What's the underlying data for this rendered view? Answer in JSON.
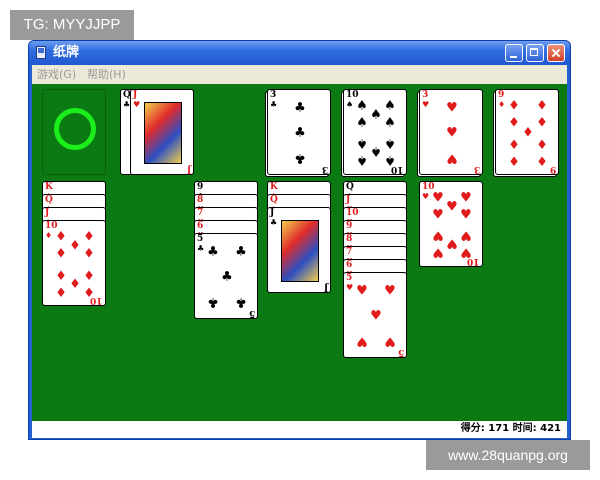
{
  "watermark_top": "TG: MYYJJPP",
  "watermark_bottom": "www.28quanpg.org",
  "window": {
    "title": "纸牌"
  },
  "menu": {
    "game": "游戏(G)",
    "help": "帮助(H)"
  },
  "status": {
    "text": "得分: 171 时间: 421"
  },
  "colors": {
    "felt": "#0c7a12",
    "ring": "#1bef1b",
    "red": "#e01b1b"
  },
  "waste": [
    "Q♣",
    "J♥"
  ],
  "foundations": [
    {
      "rank": "3",
      "suit": "♣",
      "color": "black"
    },
    {
      "rank": "10",
      "suit": "♠",
      "color": "black"
    },
    {
      "rank": "3",
      "suit": "♥",
      "color": "red"
    },
    {
      "rank": "9",
      "suit": "♦",
      "color": "red"
    }
  ],
  "tableau": [
    {
      "cards": [
        "K♦",
        "Q♦",
        "J♦",
        "10♦"
      ]
    },
    {
      "cards": []
    },
    {
      "cards": [
        "9♣",
        "8♥",
        "7♥",
        "6♥",
        "5♣"
      ]
    },
    {
      "cards": [
        "K♦",
        "Q♦",
        "J♣"
      ]
    },
    {
      "cards": [
        "Q♠",
        "J♥",
        "10♥",
        "9♥",
        "8♥",
        "7♥",
        "6♥",
        "5♥"
      ]
    },
    {
      "cards": [
        "10♥"
      ]
    }
  ]
}
